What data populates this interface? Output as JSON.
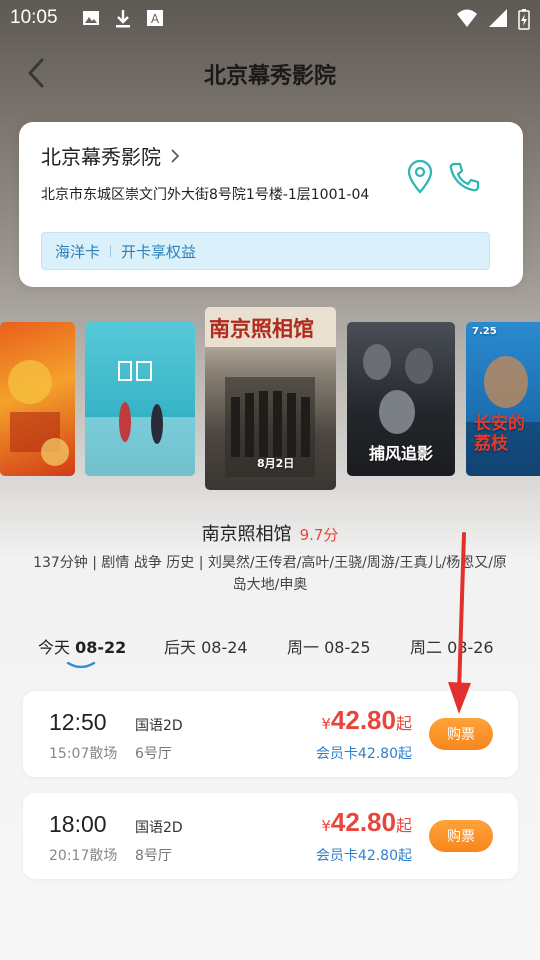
{
  "status_bar": {
    "time": "10:05"
  },
  "nav": {
    "title": "北京幕秀影院"
  },
  "cinema": {
    "name": "北京幕秀影院",
    "address": "北京市东城区崇文门外大街8号院1号楼-1层1001-04",
    "member_card_label": "海洋卡",
    "member_card_action": "开卡享权益"
  },
  "posters": {
    "poster3_title": "南京照相馆",
    "poster3_date": "8月2日",
    "poster4_title": "捕风追影",
    "poster5_title": "长安的荔枝",
    "poster5_date": "7.25"
  },
  "movie": {
    "title": "南京照相馆",
    "score": "9.7分",
    "info": "137分钟 | 剧情 战争 历史 | 刘昊然/王传君/高叶/王骁/周游/王真儿/杨恩又/原岛大地/申奥"
  },
  "date_tabs": [
    {
      "day": "今天",
      "date": "08-22"
    },
    {
      "day": "后天",
      "date": "08-24"
    },
    {
      "day": "周一",
      "date": "08-25"
    },
    {
      "day": "周二",
      "date": "08-26"
    }
  ],
  "sessions": [
    {
      "start": "12:50",
      "end": "15:07散场",
      "lang": "国语2D",
      "hall": "6号厅",
      "yen": "¥",
      "price": "42.80",
      "qi": "起",
      "member_price": "会员卡42.80起",
      "buy": "购票"
    },
    {
      "start": "18:00",
      "end": "20:17散场",
      "lang": "国语2D",
      "hall": "8号厅",
      "yen": "¥",
      "price": "42.80",
      "qi": "起",
      "member_price": "会员卡42.80起",
      "buy": "购票"
    }
  ],
  "colors": {
    "price": "#e8463c",
    "buy_button": "#f6861c",
    "member_link": "#2f7fd0",
    "accent_teal": "#29b5b5"
  }
}
